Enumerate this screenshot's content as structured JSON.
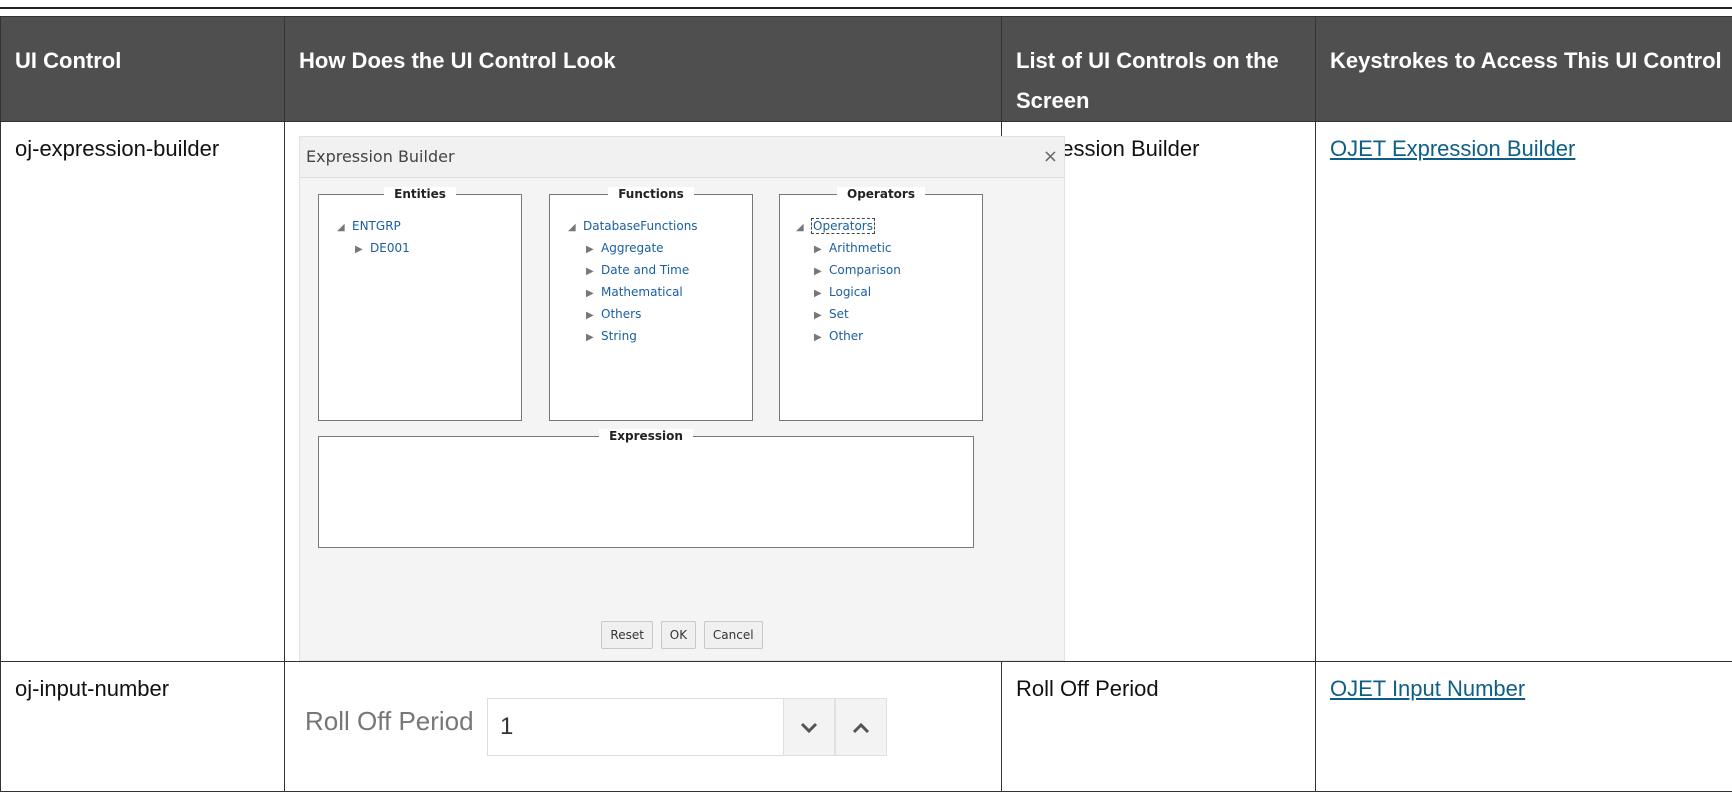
{
  "columns": [
    "UI Control",
    "How Does the UI Control Look",
    "List of UI Controls on the Screen",
    "Keystrokes to Access This UI Control"
  ],
  "rows": [
    {
      "control": "oj-expression-builder",
      "list": "Expression Builder",
      "link": "OJET Expression Builder"
    },
    {
      "control": "oj-input-number",
      "list": "Roll Off Period",
      "link": "OJET Input Number"
    }
  ],
  "dialog": {
    "title": "Expression Builder",
    "close": "×",
    "panels": {
      "entities": {
        "legend": "Entities",
        "root": "ENTGRP",
        "children": [
          "DE001"
        ]
      },
      "functions": {
        "legend": "Functions",
        "root": "DatabaseFunctions",
        "children": [
          "Aggregate",
          "Date and Time",
          "Mathematical",
          "Others",
          "String"
        ]
      },
      "operators": {
        "legend": "Operators",
        "root": "Operators",
        "children": [
          "Arithmetic",
          "Comparison",
          "Logical",
          "Set",
          "Other"
        ]
      },
      "expression": {
        "legend": "Expression"
      }
    },
    "buttons": {
      "reset": "Reset",
      "ok": "OK",
      "cancel": "Cancel"
    }
  },
  "input_number": {
    "label": "Roll Off Period",
    "value": "1",
    "down_icon": "chevron-down-icon",
    "up_icon": "chevron-up-icon"
  }
}
